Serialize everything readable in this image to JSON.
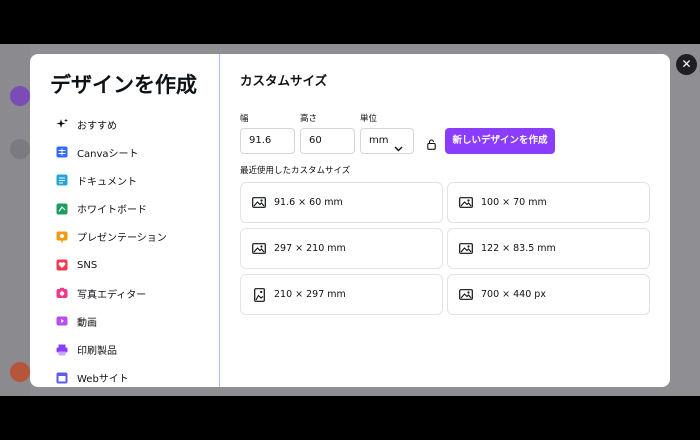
{
  "modal": {
    "title": "デザインを作成",
    "close_glyph": "✕"
  },
  "nav": {
    "items": [
      {
        "label": "おすすめ",
        "icon": "sparkle-icon",
        "color": "#0d1216"
      },
      {
        "label": "Canvaシート",
        "icon": "table-icon",
        "color": "#2f6bf6"
      },
      {
        "label": "ドキュメント",
        "icon": "document-icon",
        "color": "#22a6d9"
      },
      {
        "label": "ホワイトボード",
        "icon": "whiteboard-icon",
        "color": "#1b9d5e"
      },
      {
        "label": "プレゼンテーション",
        "icon": "presentation-icon",
        "color": "#f29a11"
      },
      {
        "label": "SNS",
        "icon": "heart-icon",
        "color": "#ef3a4f"
      },
      {
        "label": "写真エディター",
        "icon": "camera-icon",
        "color": "#ef3a8a"
      },
      {
        "label": "動画",
        "icon": "video-icon",
        "color": "#b94df0"
      },
      {
        "label": "印刷製品",
        "icon": "printer-icon",
        "color": "#8b3dff"
      },
      {
        "label": "Webサイト",
        "icon": "website-icon",
        "color": "#5b5bf0"
      }
    ]
  },
  "custom": {
    "title": "カスタムサイズ",
    "width_label": "幅",
    "height_label": "高さ",
    "unit_label": "単位",
    "width_value": "91.6",
    "height_value": "60",
    "unit_value": "mm",
    "create_label": "新しいデザインを作成",
    "recent_label": "最近使用したカスタムサイズ"
  },
  "recent": [
    {
      "label": "91.6 × 60 mm",
      "icon": "image-landscape-icon"
    },
    {
      "label": "100 × 70 mm",
      "icon": "image-landscape-icon"
    },
    {
      "label": "297 × 210 mm",
      "icon": "image-landscape-icon"
    },
    {
      "label": "122 × 83.5 mm",
      "icon": "image-landscape-icon"
    },
    {
      "label": "210 × 297 mm",
      "icon": "image-portrait-icon"
    },
    {
      "label": "700 × 440 px",
      "icon": "image-landscape-icon"
    }
  ],
  "colors": {
    "accent": "#8b3dff",
    "backdrop": "#8f8f93"
  }
}
